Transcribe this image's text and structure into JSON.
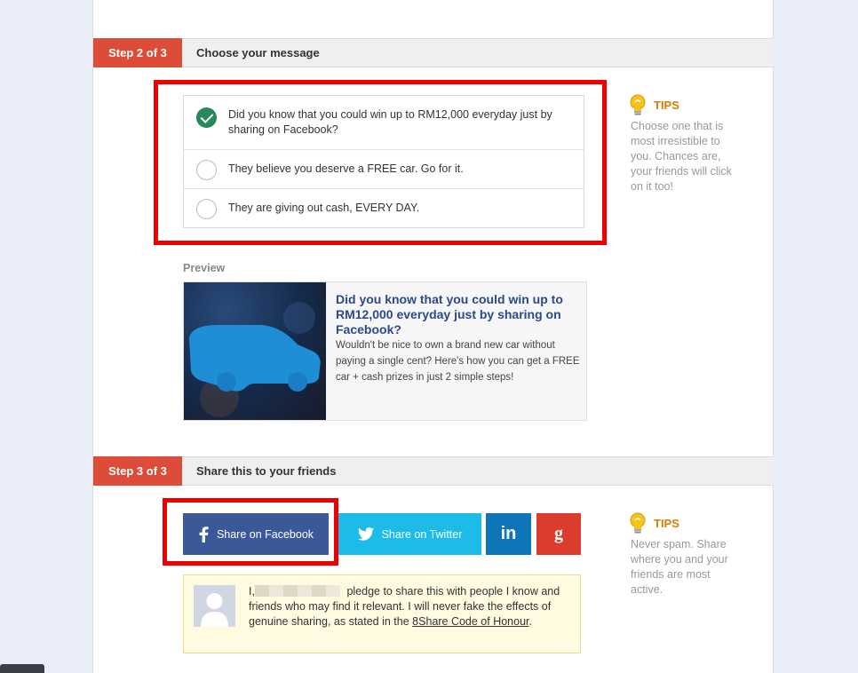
{
  "step2": {
    "badge": "Step 2 of 3",
    "title": "Choose your message",
    "messages": [
      {
        "text": "Did you know that you could win up to RM12,000 everyday just by sharing on Facebook?",
        "selected": true
      },
      {
        "text": "They believe you deserve a FREE car. Go for it.",
        "selected": false
      },
      {
        "text": "They are giving out cash, EVERY DAY.",
        "selected": false
      }
    ],
    "tips": {
      "heading": "TIPS",
      "text": "Choose one that is most irresistible to you. Chances are, your friends will click on it too!"
    },
    "preview": {
      "label": "Preview",
      "title": "Did you know that you could win up to RM12,000 everyday just by sharing on Facebook?",
      "description": "Wouldn't be nice to own a brand new car without paying a single cent? Here's how you can get a FREE car + cash prizes in just 2 simple steps!"
    }
  },
  "step3": {
    "badge": "Step 3 of 3",
    "title": "Share this to your friends",
    "buttons": {
      "facebook": "Share on Facebook",
      "twitter": "Share on Twitter",
      "linkedin_icon": "in",
      "gplus_icon": "g"
    },
    "tips": {
      "heading": "TIPS",
      "text": "Never spam. Share where you and your friends are most active."
    },
    "pledge": {
      "prefix": "I,",
      "text": "pledge to share this with people I know and friends who may find it relevant. I will never fake the effects of genuine sharing, as stated in the",
      "link": "8Share Code of Honour",
      "suffix": "."
    }
  },
  "colors": {
    "step_badge": "#dd4b39",
    "facebook": "#3b5998",
    "twitter": "#1dbce8",
    "linkedin": "#0e76b6",
    "gplus": "#dc3c2c",
    "checked": "#27895a",
    "highlight": "#ee0000",
    "tips": "#d87f00"
  },
  "icons": [
    "check-icon",
    "lightbulb-icon",
    "facebook-icon",
    "twitter-icon",
    "linkedin-icon",
    "google-plus-icon",
    "avatar-icon",
    "car-silhouette"
  ]
}
